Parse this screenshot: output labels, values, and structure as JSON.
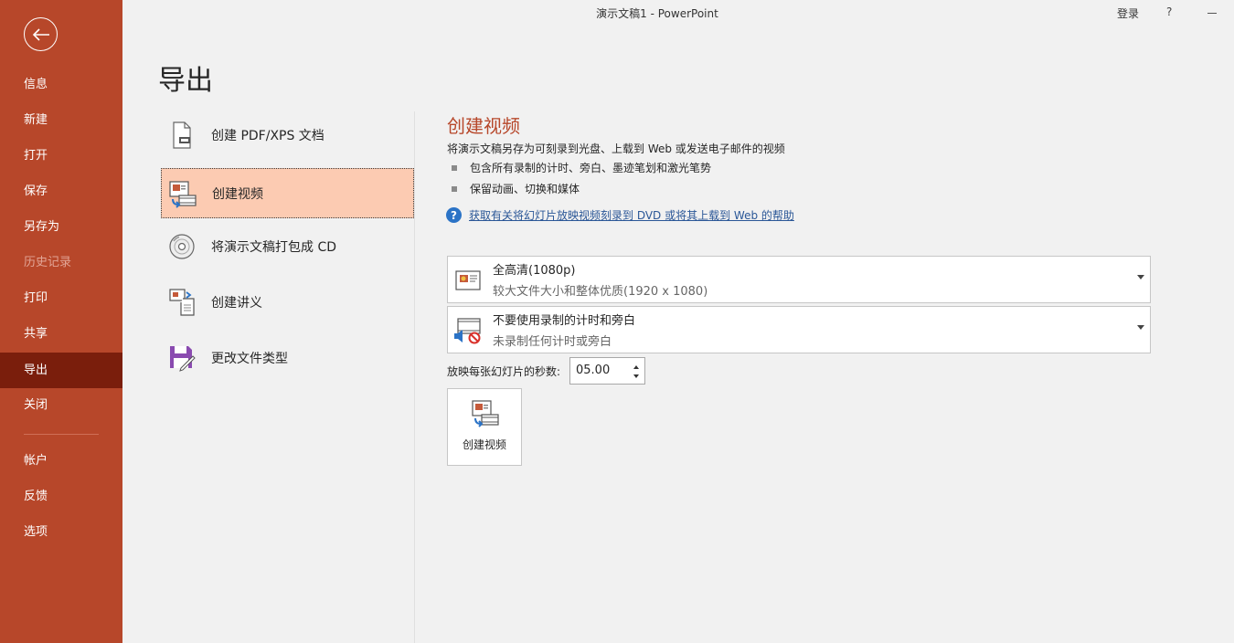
{
  "titlebar": {
    "title": "演示文稿1  -  PowerPoint",
    "signin": "登录",
    "help": "?"
  },
  "sidebar": {
    "items": [
      {
        "label": "信息"
      },
      {
        "label": "新建"
      },
      {
        "label": "打开"
      },
      {
        "label": "保存"
      },
      {
        "label": "另存为"
      },
      {
        "label": "历史记录"
      },
      {
        "label": "打印"
      },
      {
        "label": "共享"
      },
      {
        "label": "导出"
      },
      {
        "label": "关闭"
      },
      {
        "label": "帐户"
      },
      {
        "label": "反馈"
      },
      {
        "label": "选项"
      }
    ],
    "active": "导出"
  },
  "page": {
    "title": "导出"
  },
  "options": [
    {
      "label": "创建 PDF/XPS 文档"
    },
    {
      "label": "创建视频"
    },
    {
      "label": "将演示文稿打包成 CD"
    },
    {
      "label": "创建讲义"
    },
    {
      "label": "更改文件类型"
    }
  ],
  "panel": {
    "title": "创建视频",
    "description": "将演示文稿另存为可刻录到光盘、上载到 Web 或发送电子邮件的视频",
    "bullets": [
      "包含所有录制的计时、旁白、墨迹笔划和激光笔势",
      "保留动画、切换和媒体"
    ],
    "help_link": "获取有关将幻灯片放映视频刻录到 DVD 或将其上载到 Web 的帮助",
    "quality": {
      "main": "全高清(1080p)",
      "sub": "较大文件大小和整体优质(1920 x 1080)"
    },
    "timing": {
      "main": "不要使用录制的计时和旁白",
      "sub": "未录制任何计时或旁白"
    },
    "seconds_label": "放映每张幻灯片的秒数:",
    "seconds_value": "05.00",
    "create_button": "创建视频"
  },
  "colors": {
    "accent": "#b7472a",
    "active_nav": "#7a1e0c",
    "selected_option": "#fccbb2",
    "link": "#2b5797"
  }
}
